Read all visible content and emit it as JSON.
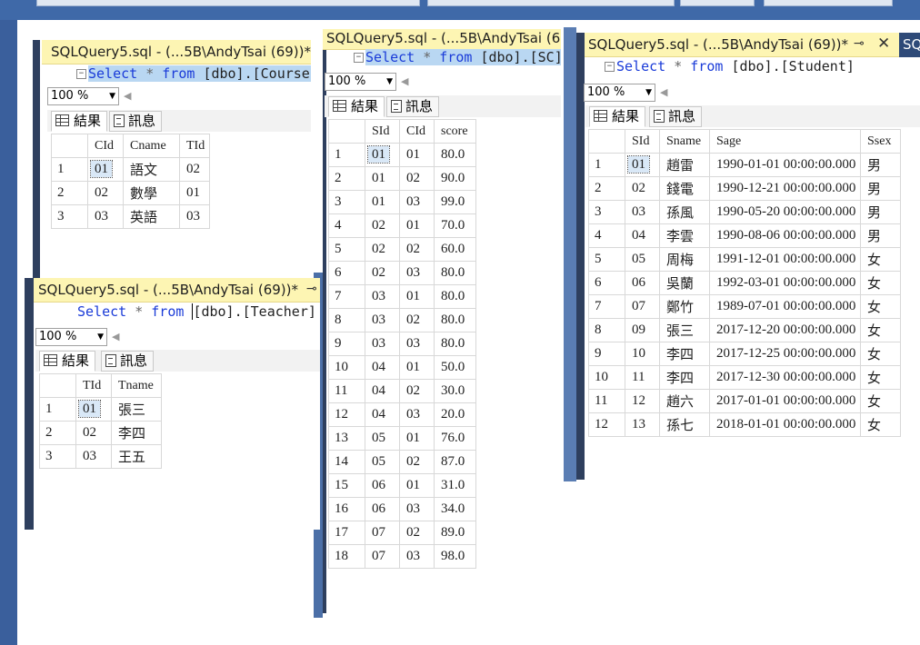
{
  "sql_keywords": {
    "select": "Select",
    "from": "from"
  },
  "zoom": "100 %",
  "results_tab": "結果",
  "messages_tab": "訊息",
  "course": {
    "tab_title": "SQLQuery5.sql - (...5B\\AndyTsai (69))*",
    "table_ref": "[dbo].[Course]",
    "columns": [
      "",
      "CId",
      "Cname",
      "TId"
    ],
    "rows": [
      [
        "1",
        "01",
        "語文",
        "02"
      ],
      [
        "2",
        "02",
        "數學",
        "01"
      ],
      [
        "3",
        "03",
        "英語",
        "03"
      ]
    ]
  },
  "teacher": {
    "tab_title": "SQLQuery5.sql - (...5B\\AndyTsai (69))*",
    "table_ref": "[dbo].[Teacher]",
    "columns": [
      "",
      "TId",
      "Tname"
    ],
    "rows": [
      [
        "1",
        "01",
        "張三"
      ],
      [
        "2",
        "02",
        "李四"
      ],
      [
        "3",
        "03",
        "王五"
      ]
    ]
  },
  "sc": {
    "tab_title": "SQLQuery5.sql - (...5B\\AndyTsai (6",
    "table_ref": "[dbo].[SC]",
    "columns": [
      "",
      "SId",
      "CId",
      "score"
    ],
    "rows": [
      [
        "1",
        "01",
        "01",
        "80.0"
      ],
      [
        "2",
        "01",
        "02",
        "90.0"
      ],
      [
        "3",
        "01",
        "03",
        "99.0"
      ],
      [
        "4",
        "02",
        "01",
        "70.0"
      ],
      [
        "5",
        "02",
        "02",
        "60.0"
      ],
      [
        "6",
        "02",
        "03",
        "80.0"
      ],
      [
        "7",
        "03",
        "01",
        "80.0"
      ],
      [
        "8",
        "03",
        "02",
        "80.0"
      ],
      [
        "9",
        "03",
        "03",
        "80.0"
      ],
      [
        "10",
        "04",
        "01",
        "50.0"
      ],
      [
        "11",
        "04",
        "02",
        "30.0"
      ],
      [
        "12",
        "04",
        "03",
        "20.0"
      ],
      [
        "13",
        "05",
        "01",
        "76.0"
      ],
      [
        "14",
        "05",
        "02",
        "87.0"
      ],
      [
        "15",
        "06",
        "01",
        "31.0"
      ],
      [
        "16",
        "06",
        "03",
        "34.0"
      ],
      [
        "17",
        "07",
        "02",
        "89.0"
      ],
      [
        "18",
        "07",
        "03",
        "98.0"
      ]
    ]
  },
  "student": {
    "tab_title": "SQLQuery5.sql - (...5B\\AndyTsai (69))*",
    "next_tab": "SQ",
    "table_ref": "[dbo].[Student]",
    "columns": [
      "",
      "SId",
      "Sname",
      "Sage",
      "Ssex"
    ],
    "rows": [
      [
        "1",
        "01",
        "趙雷",
        "1990-01-01 00:00:00.000",
        "男"
      ],
      [
        "2",
        "02",
        "錢電",
        "1990-12-21 00:00:00.000",
        "男"
      ],
      [
        "3",
        "03",
        "孫風",
        "1990-05-20 00:00:00.000",
        "男"
      ],
      [
        "4",
        "04",
        "李雲",
        "1990-08-06 00:00:00.000",
        "男"
      ],
      [
        "5",
        "05",
        "周梅",
        "1991-12-01 00:00:00.000",
        "女"
      ],
      [
        "6",
        "06",
        "吳蘭",
        "1992-03-01 00:00:00.000",
        "女"
      ],
      [
        "7",
        "07",
        "鄭竹",
        "1989-07-01 00:00:00.000",
        "女"
      ],
      [
        "8",
        "09",
        "張三",
        "2017-12-20 00:00:00.000",
        "女"
      ],
      [
        "9",
        "10",
        "李四",
        "2017-12-25 00:00:00.000",
        "女"
      ],
      [
        "10",
        "11",
        "李四",
        "2017-12-30 00:00:00.000",
        "女"
      ],
      [
        "11",
        "12",
        "趙六",
        "2017-01-01 00:00:00.000",
        "女"
      ],
      [
        "12",
        "13",
        "孫七",
        "2018-01-01 00:00:00.000",
        "女"
      ]
    ]
  }
}
